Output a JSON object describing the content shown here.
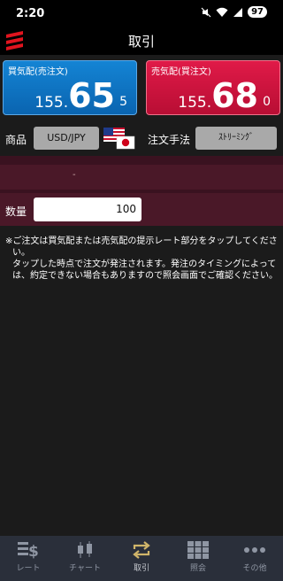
{
  "status_bar": {
    "time": "2:20",
    "battery": "97"
  },
  "header": {
    "title": "取引"
  },
  "bid": {
    "label": "買気配(売注文)",
    "price_prefix": "155.",
    "price_big": "65",
    "price_tail": "5"
  },
  "ask": {
    "label": "売気配(買注文)",
    "price_prefix": "155.",
    "price_big": "68",
    "price_tail": "0"
  },
  "product": {
    "label": "商品",
    "value": "USD/JPY"
  },
  "order_method": {
    "label": "注文手法",
    "value": "ｽﾄﾘｰﾐﾝｸﾞ"
  },
  "info_row": {
    "value": "-"
  },
  "quantity": {
    "label": "数量",
    "value": "100"
  },
  "notice": {
    "line1": "※ご注文は買気配または売気配の提示レート部分をタップしてください。",
    "line2": "タップした時点で注文が発注されます。発注のタイミングによっては、約定できない場合もありますので照会画面でご確認ください。"
  },
  "bottom_nav": [
    {
      "label": "レート",
      "icon": "rate-icon"
    },
    {
      "label": "チャート",
      "icon": "chart-icon"
    },
    {
      "label": "取引",
      "icon": "trade-icon",
      "active": true
    },
    {
      "label": "照会",
      "icon": "grid-icon"
    },
    {
      "label": "その他",
      "icon": "more-icon"
    }
  ],
  "colors": {
    "bid": "#0a64b0",
    "ask": "#c8103a",
    "stripe": "#4a1828",
    "nav_bg": "#2a2f3a"
  }
}
